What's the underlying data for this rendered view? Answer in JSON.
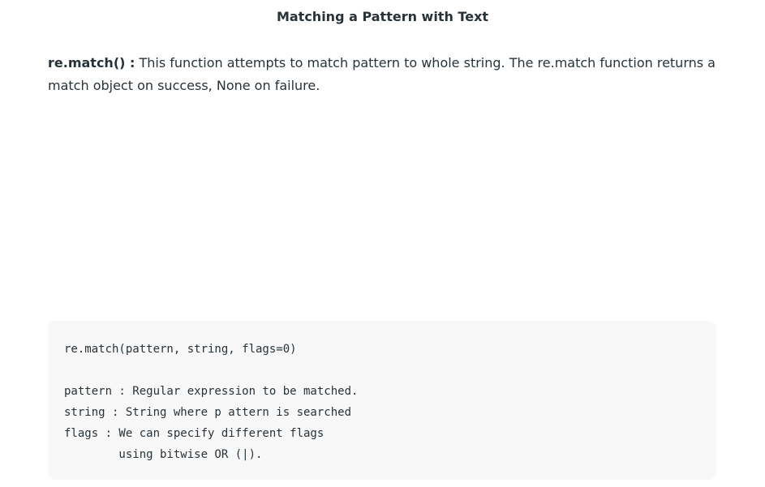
{
  "title": "Matching a Pattern with Text",
  "intro": {
    "term": "re.match() :",
    "text": " This function attempts to match pattern to whole string. The re.match function returns a match object on success, None on failure."
  },
  "code": {
    "lines": [
      "re.match(pattern, string, flags=0)",
      "",
      "pattern : Regular expression to be matched.",
      "string : String where p attern is searched",
      "flags : We can specify different flags",
      "        using bitwise OR (|)."
    ]
  }
}
